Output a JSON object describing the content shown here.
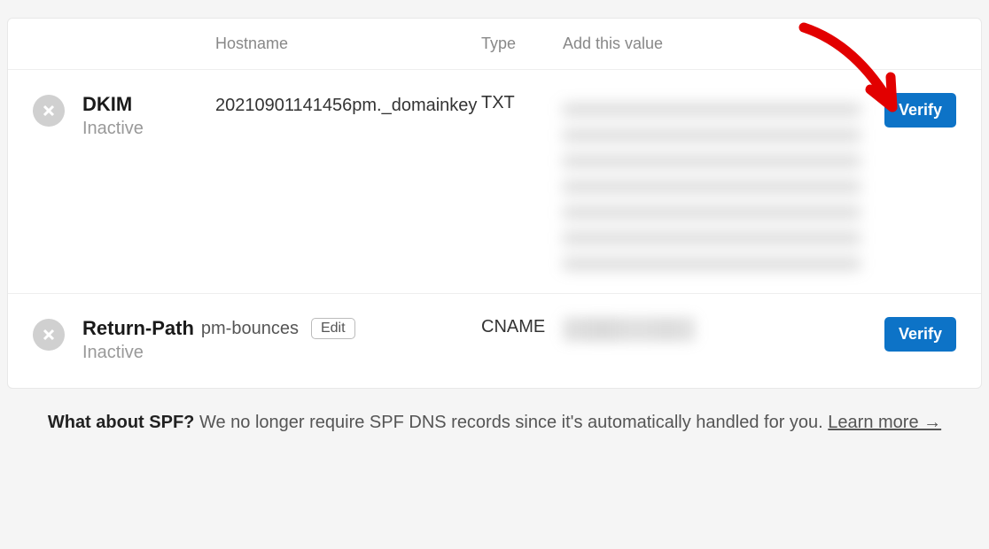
{
  "headers": {
    "hostname": "Hostname",
    "type": "Type",
    "value": "Add this value"
  },
  "rows": [
    {
      "name": "DKIM",
      "status": "Inactive",
      "hostname": "20210901141456pm._domainkey",
      "type": "TXT",
      "verify_label": "Verify"
    },
    {
      "name": "Return-Path",
      "status": "Inactive",
      "hostname": "pm-bounces",
      "edit_label": "Edit",
      "type": "CNAME",
      "verify_label": "Verify"
    }
  ],
  "spf": {
    "lead": "What about SPF?",
    "text": "We no longer require SPF DNS records since it's automatically handled for you.",
    "link": "Learn more →"
  }
}
